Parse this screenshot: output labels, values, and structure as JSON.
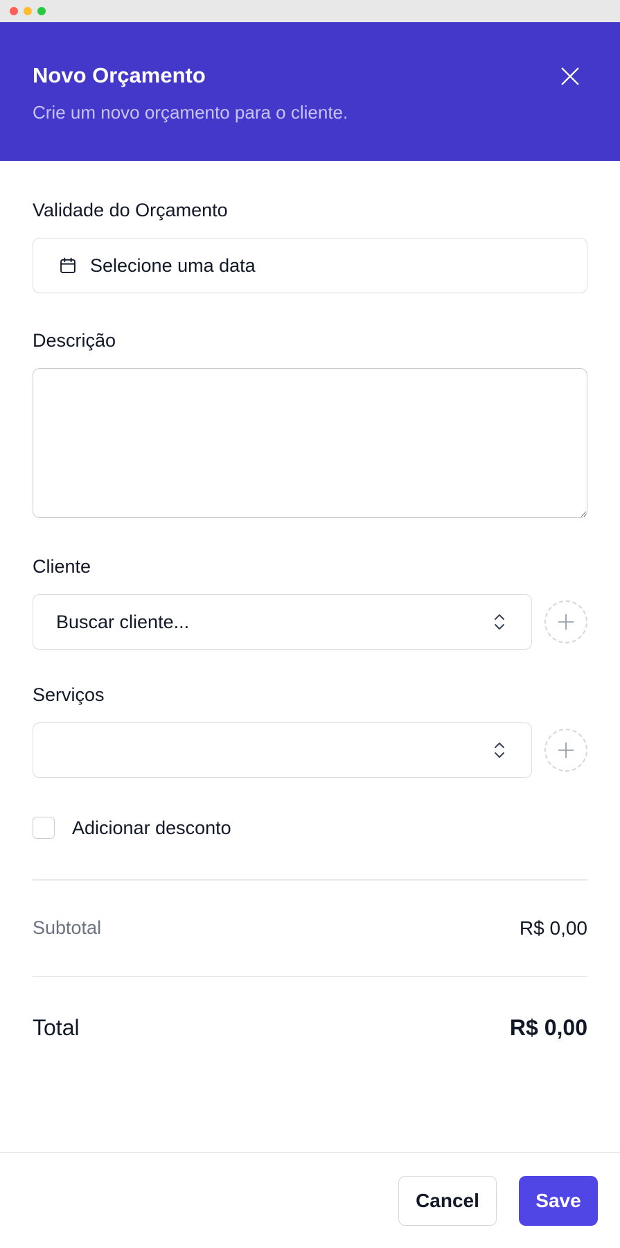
{
  "header": {
    "title": "Novo Orçamento",
    "subtitle": "Crie um novo orçamento para o cliente."
  },
  "form": {
    "validity": {
      "label": "Validade do Orçamento",
      "placeholder": "Selecione uma data"
    },
    "description": {
      "label": "Descrição",
      "value": ""
    },
    "client": {
      "label": "Cliente",
      "placeholder": "Buscar cliente..."
    },
    "services": {
      "label": "Serviços",
      "value": ""
    },
    "discount": {
      "label": "Adicionar desconto",
      "checked": false
    }
  },
  "summary": {
    "subtotal_label": "Subtotal",
    "subtotal_value": "R$ 0,00",
    "total_label": "Total",
    "total_value": "R$ 0,00"
  },
  "footer": {
    "cancel_label": "Cancel",
    "save_label": "Save"
  },
  "colors": {
    "header_bg": "#4338ca",
    "primary": "#4f46e5"
  },
  "icons": [
    "close-icon",
    "calendar-icon",
    "chevron-up-down-icon",
    "plus-icon"
  ]
}
